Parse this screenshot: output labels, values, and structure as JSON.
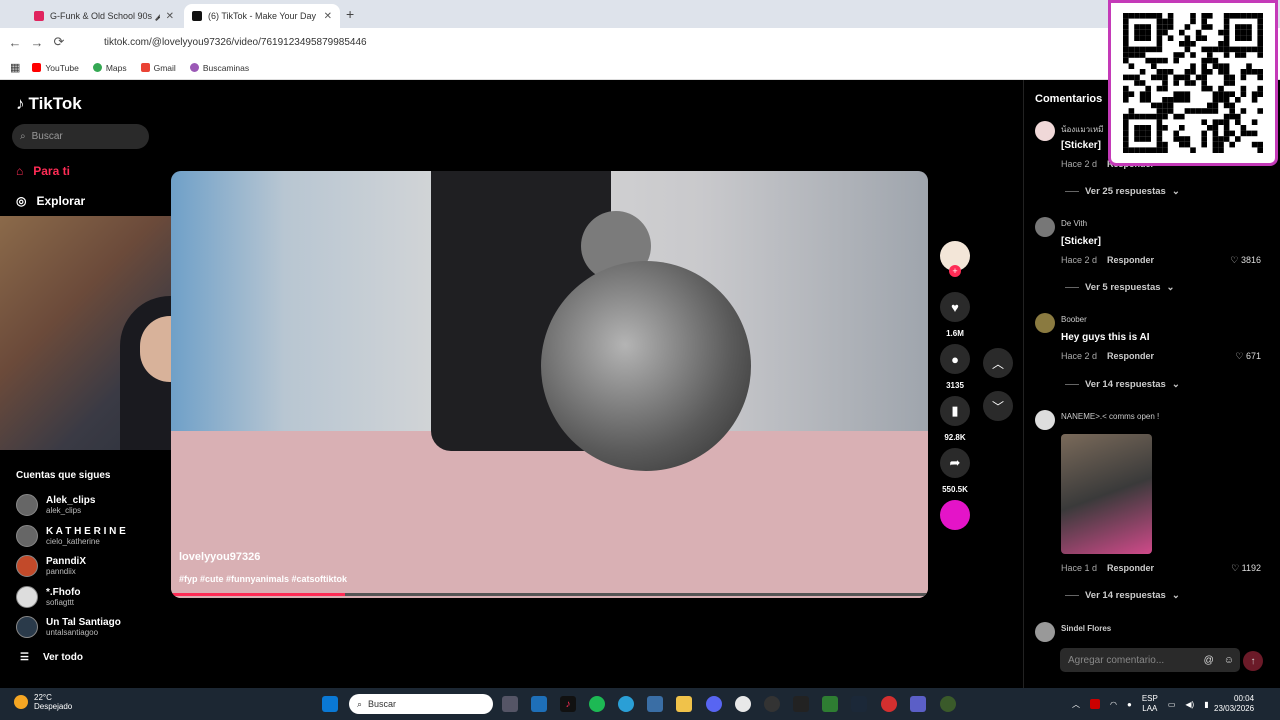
{
  "browser": {
    "tabs": [
      {
        "label": "G-Funk & Old School 90s 🎤 Sn",
        "active": false
      },
      {
        "label": "(6) TikTok - Make Your Day",
        "active": true
      }
    ],
    "url": "tiktok.com/@lovelyyou97326/video/7619123495879985446",
    "bookmarks": [
      "YouTube",
      "Maps",
      "Gmail",
      "Buscaminas"
    ]
  },
  "sidebar": {
    "brand": "TikTok",
    "search_placeholder": "Buscar",
    "menu": [
      {
        "label": "Para ti",
        "icon": "home-icon"
      },
      {
        "label": "Explorar",
        "icon": "compass-icon"
      }
    ],
    "following_title": "Cuentas que sigues",
    "accounts": [
      {
        "name": "Alek_clips",
        "user": "alek_clips"
      },
      {
        "name": "K A T H E R I N E",
        "user": "cielo_katherine"
      },
      {
        "name": "PanndiX",
        "user": "panndiix"
      },
      {
        "name": "*.Fhofo",
        "user": "sofiagttt"
      },
      {
        "name": "Un Tal Santiago",
        "user": "untalsantiagoo"
      }
    ],
    "see_all": "Ver todo"
  },
  "video": {
    "author": "lovelyyou97326",
    "hashtags": "#fyp #cute #funnyanimals #catsoftiktok",
    "progress": 0.23
  },
  "actions": {
    "likes": "1.6M",
    "comments": "3135",
    "saves": "92.8K",
    "shares": "550.5K"
  },
  "comments": {
    "title": "Comentarios",
    "items": [
      {
        "user": "น้องแมวเหมี",
        "text": "[Sticker]",
        "time": "Hace 2 d",
        "reply": "Responder",
        "likes": "",
        "more": "Ver 25 respuestas"
      },
      {
        "user": "De Vith",
        "text": "[Sticker]",
        "time": "Hace 2 d",
        "reply": "Responder",
        "likes": "3816",
        "more": "Ver 5 respuestas"
      },
      {
        "user": "Boober",
        "text": "Hey guys this is AI",
        "time": "Hace 2 d",
        "reply": "Responder",
        "likes": "671",
        "more": "Ver 14 respuestas"
      },
      {
        "user": "NANEME>.< comms open !",
        "text": "",
        "time": "Hace 1 d",
        "reply": "Responder",
        "likes": "1192",
        "more": "Ver 14 respuestas"
      },
      {
        "user": "Sindel Flores",
        "text": "",
        "time": "",
        "reply": "",
        "likes": "",
        "more": ""
      }
    ],
    "add_placeholder": "Agregar comentario..."
  },
  "taskbar": {
    "temperature": "22°C",
    "weather": "Despejado",
    "search": "Buscar",
    "lang": "ESP",
    "region": "LAA",
    "time": "00:04",
    "date": "23/03/2026"
  }
}
